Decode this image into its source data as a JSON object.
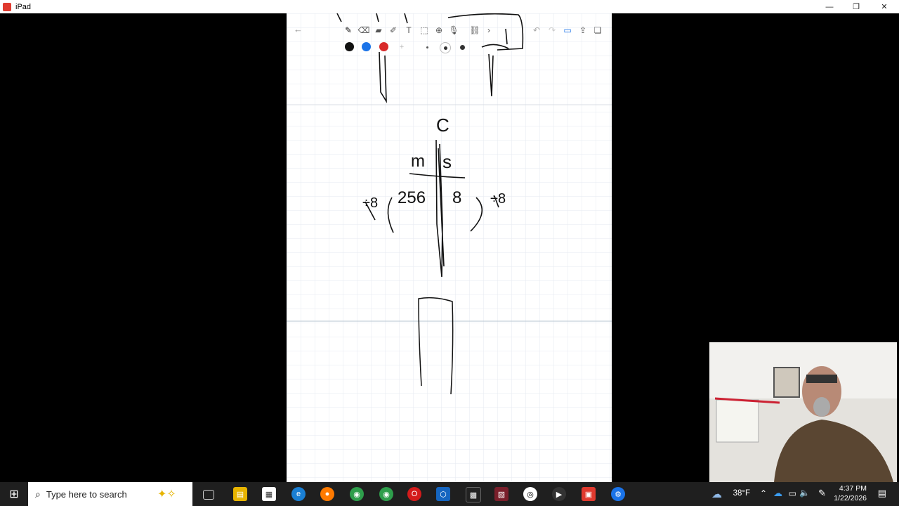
{
  "window": {
    "title": "iPad",
    "minimize_glyph": "—",
    "restore_glyph": "❐",
    "close_glyph": "✕"
  },
  "notes": {
    "toolbar": {
      "tools": [
        "pen",
        "eraser",
        "highlighter",
        "pencil",
        "text",
        "crop",
        "add",
        "microphone",
        "link",
        "more"
      ],
      "colors": [
        "#111111",
        "#1a73e8",
        "#d82a2a"
      ],
      "undo_glyph": "↶",
      "redo_glyph": "↷"
    },
    "handwriting": {
      "top_label": "C",
      "left_label": "m",
      "right_label": "s",
      "left_value": "256",
      "right_value": "8",
      "left_divisor": "÷8",
      "right_divisor": "÷8"
    }
  },
  "taskbar": {
    "search_placeholder": "Type here to search",
    "weather": "38°F",
    "time": "4:37 PM",
    "date": "1/22/2026",
    "accent": "#0078d4"
  }
}
